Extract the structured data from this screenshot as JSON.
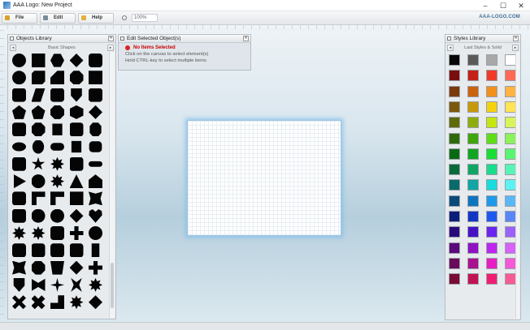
{
  "window": {
    "title": "AAA Logo: New Project",
    "controls": [
      "–",
      "☐",
      "✕"
    ]
  },
  "menu": {
    "items": [
      {
        "label": "File",
        "icon": "file-icon",
        "color": "#d8a32b"
      },
      {
        "label": "Edit",
        "icon": "edit-icon",
        "color": "#7a8c9c"
      },
      {
        "label": "Help",
        "icon": "help-icon",
        "color": "#e0b13c"
      }
    ],
    "zoom": "100%",
    "brand": "AAA-LOGO.COM"
  },
  "objects_library": {
    "title": "Objects Library",
    "category": "Basic Shapes",
    "prev": "◂",
    "next": "▸",
    "shapes": [
      "circle",
      "square",
      "hexagon",
      "diamond",
      "rounded-square",
      "circle",
      "notched-square",
      "trapezoid",
      "octagon",
      "square",
      "rounded-square",
      "parallelogram",
      "rounded-square",
      "shield",
      "bevel-square",
      "pentagon",
      "pentagon",
      "octagon",
      "cube",
      "diamond",
      "rounded-square",
      "octagon",
      "rect",
      "rounded-square",
      "octagon-tall",
      "ellipse",
      "oval",
      "stadium",
      "rect",
      "rounded-rect",
      "rounded-square",
      "star5",
      "star8",
      "rounded-square",
      "pill",
      "play",
      "circle",
      "star8",
      "triangle",
      "house",
      "rounded-square",
      "l-shape",
      "l-shape",
      "square",
      "concave-square",
      "rounded-square",
      "circle",
      "circle",
      "diamond",
      "heart",
      "star8",
      "star8",
      "rounded-square",
      "cross",
      "circle",
      "rounded-square",
      "rounded-square",
      "rounded-square",
      "rounded-square",
      "tall-rect",
      "concave-square",
      "octagon",
      "cup",
      "diamond",
      "cross",
      "shield",
      "bowtie",
      "star4",
      "x-star",
      "star8",
      "x-shape",
      "x-cross",
      "step",
      "star8",
      "diamond"
    ]
  },
  "edit_panel": {
    "title": "Edit Selected Object(s)",
    "warning": "No Items Selected",
    "lines": [
      "Click on the canvas to select element(s)",
      "Hold CTRL-key to select multiple items"
    ]
  },
  "styles_library": {
    "title": "Styles Library",
    "category": "Last Styles & Solid",
    "prev": "◂",
    "next": "▸",
    "swatches": [
      "#070707",
      "#5a5a5a",
      "#a8a8a8",
      "#ffffff",
      "#7a0e0e",
      "#c4201a",
      "#ef3a2a",
      "#ff6a55",
      "#7a3a0c",
      "#c9630f",
      "#f1901c",
      "#ffb343",
      "#7a5a0a",
      "#c79908",
      "#f5d20d",
      "#ffe455",
      "#5e6a08",
      "#8fad0a",
      "#c6e60f",
      "#d9f45a",
      "#2f6a0a",
      "#3fa50c",
      "#5fde18",
      "#8df25a",
      "#0a6a14",
      "#11a522",
      "#19de33",
      "#5af56f",
      "#0a6a3a",
      "#11a564",
      "#19dc8c",
      "#58f4b6",
      "#0a6a6a",
      "#11a5a5",
      "#19dcdc",
      "#5af2f2",
      "#0a4a7a",
      "#0f74c0",
      "#1e9ae8",
      "#5ab8f6",
      "#0a1f7a",
      "#1236c4",
      "#1e5af0",
      "#5a86f8",
      "#2a0a7a",
      "#4612c4",
      "#6a26f0",
      "#9a62f8",
      "#5a0a7a",
      "#8e12c4",
      "#be26f0",
      "#d662f8",
      "#6a0a5a",
      "#a8128e",
      "#e61ec4",
      "#f45ad8",
      "#7a0a36",
      "#c21256",
      "#f01e72",
      "#f85a94"
    ]
  }
}
